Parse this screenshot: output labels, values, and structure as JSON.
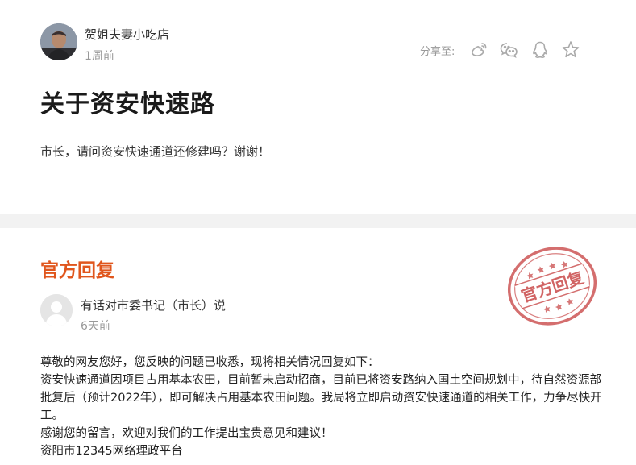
{
  "post": {
    "author": "贺姐夫妻小吃店",
    "time": "1周前",
    "share_label": "分享至:",
    "share_icons": [
      "weibo-icon",
      "wechat-icon",
      "qq-icon",
      "star-icon"
    ],
    "title": "关于资安快速路",
    "body": "市长，请问资安快速通道还修建吗？谢谢！"
  },
  "reply": {
    "heading": "官方回复",
    "stamp_text": "官方回复",
    "replier": "有话对市委书记（市长）说",
    "time": "6天前",
    "paragraphs": [
      "尊敬的网友您好，您反映的问题已收悉，现将相关情况回复如下：",
      "资安快速通道因项目占用基本农田，目前暂未启动招商，目前已将资安路纳入国土空间规划中，待自然资源部批复后（预计2022年），即可解决占用基本农田问题。我局将立即启动资安快速通道的相关工作，力争尽快开工。",
      "感谢您的留言，欢迎对我们的工作提出宝贵意见和建议！",
      "资阳市12345网络理政平台"
    ]
  },
  "colors": {
    "accent": "#e0561d",
    "stamp": "#c94a4a",
    "muted": "#999999",
    "divider": "#f2f2f2"
  }
}
